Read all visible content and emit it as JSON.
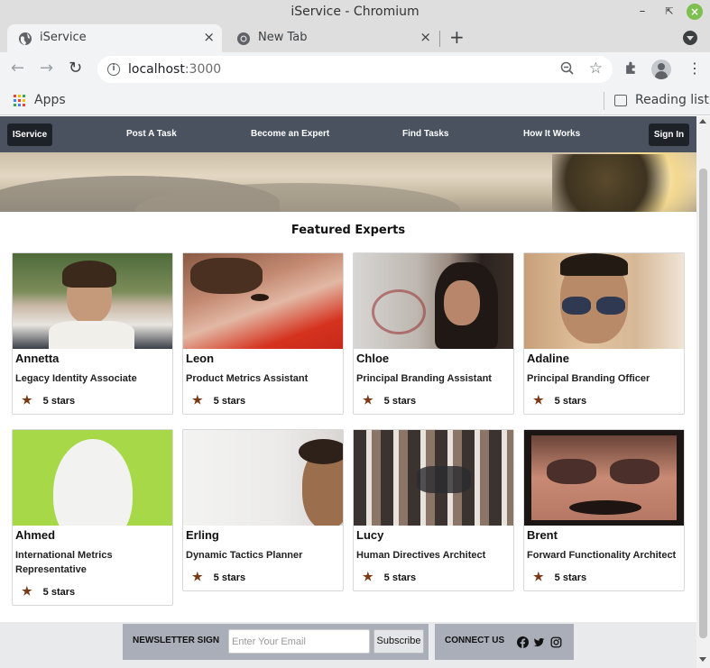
{
  "window": {
    "title": "iService - Chromium"
  },
  "tabs": [
    {
      "title": "iService",
      "active": true
    },
    {
      "title": "New Tab",
      "active": false
    }
  ],
  "toolbar": {
    "url_host": "localhost",
    "url_port": ":3000"
  },
  "bookmarks": {
    "apps_label": "Apps",
    "reading_list_label": "Reading list"
  },
  "site_nav": {
    "brand": "IService",
    "links": [
      "Post A Task",
      "Become an Expert",
      "Find Tasks",
      "How It Works"
    ],
    "signin": "Sign In"
  },
  "featured": {
    "title": "Featured Experts",
    "experts": [
      {
        "name": "Annetta",
        "role": "Legacy Identity Associate",
        "rating": "5 stars"
      },
      {
        "name": "Leon",
        "role": "Product Metrics Assistant",
        "rating": "5 stars"
      },
      {
        "name": "Chloe",
        "role": "Principal Branding Assistant",
        "rating": "5 stars"
      },
      {
        "name": "Adaline",
        "role": "Principal Branding Officer",
        "rating": "5 stars"
      },
      {
        "name": "Ahmed",
        "role": "International Metrics Representative",
        "rating": "5 stars"
      },
      {
        "name": "Erling",
        "role": "Dynamic Tactics Planner",
        "rating": "5 stars"
      },
      {
        "name": "Lucy",
        "role": "Human Directives Architect",
        "rating": "5 stars"
      },
      {
        "name": "Brent",
        "role": "Forward Functionality Architect",
        "rating": "5 stars"
      }
    ]
  },
  "footer": {
    "newsletter_label": "NEWSLETTER SIGN",
    "email_placeholder": "Enter Your Email",
    "subscribe_label": "Subscribe",
    "connect_label": "CONNECT US",
    "social_icons": [
      "facebook-icon",
      "twitter-icon",
      "instagram-icon"
    ]
  },
  "colors": {
    "nav_bg": "#4a5260",
    "nav_button": "#1d2229",
    "star": "#7a3a18",
    "footer_box": "#a9aeb8"
  }
}
